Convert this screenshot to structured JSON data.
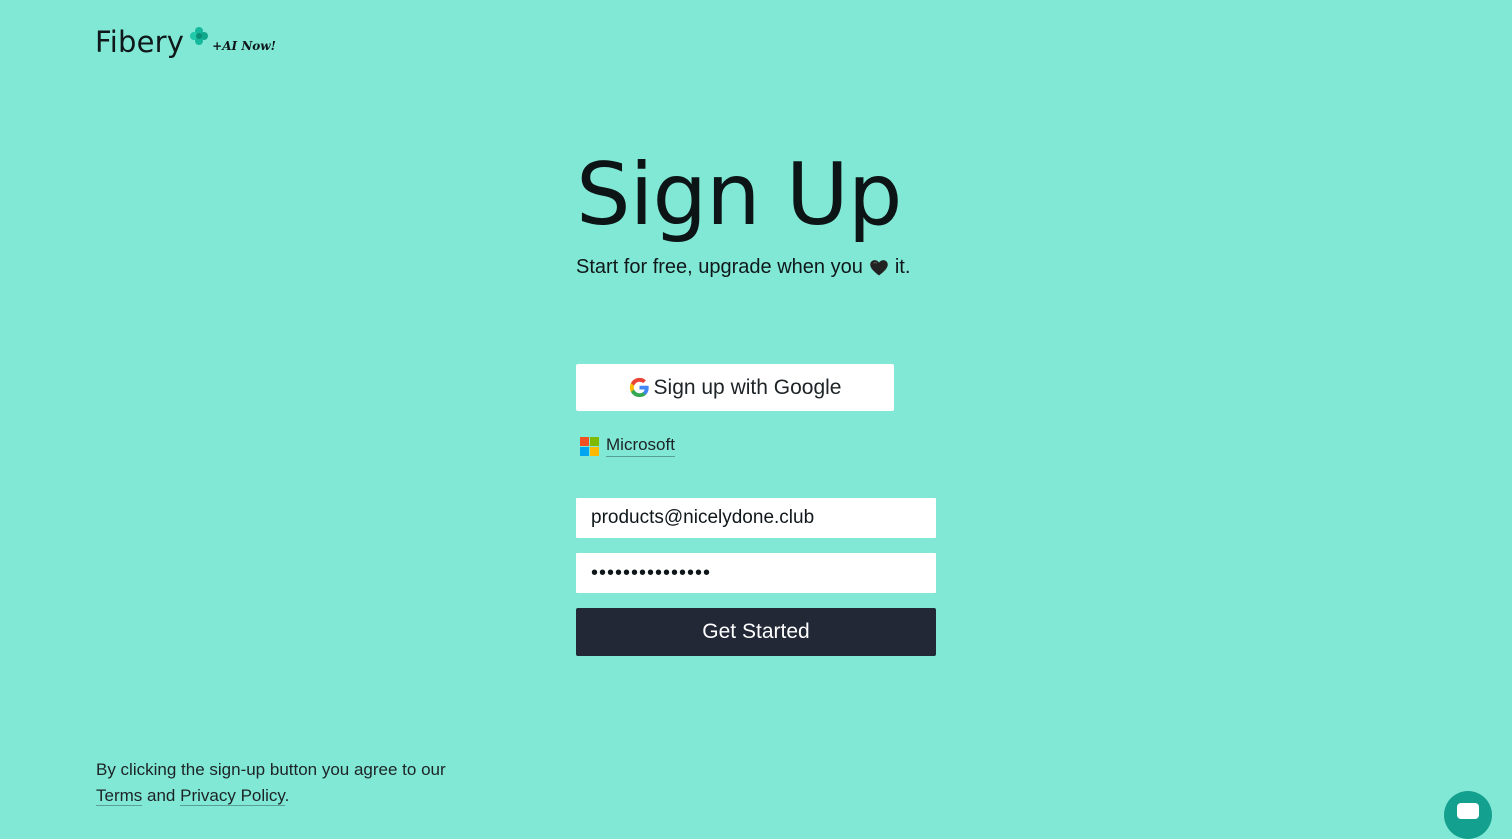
{
  "brand": {
    "name": "Fibery",
    "tagline": "+AI Now!",
    "accent_color": "#80e8d4",
    "mark_color": "#16b89c"
  },
  "signup": {
    "title": "Sign Up",
    "subtitle_before": "Start for free, upgrade when you",
    "subtitle_icon": "black-heart-icon",
    "subtitle_after": "it.",
    "google_button_label": "Sign up with Google",
    "microsoft_link_label": "Microsoft",
    "email_value": "products@nicelydone.club",
    "password_value": "•••••••••••••••",
    "submit_label": "Get Started",
    "submit_color": "#232836"
  },
  "legal": {
    "text_before": "By clicking the sign-up button you agree to our",
    "terms_label": "Terms",
    "joiner": "and",
    "privacy_label": "Privacy Policy",
    "end": "."
  },
  "chat": {
    "icon": "chat-bubble-icon"
  }
}
